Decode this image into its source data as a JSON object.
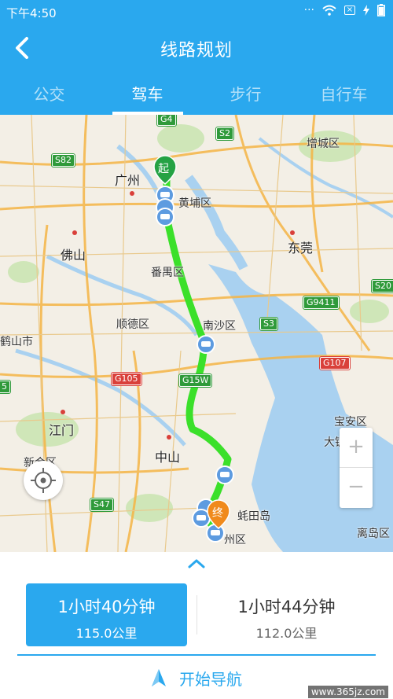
{
  "status_bar": {
    "time": "下午4:50",
    "dots": "···",
    "sim_icon": "x-box-icon"
  },
  "header": {
    "title": "线路规划"
  },
  "tabs": [
    {
      "label": "公交"
    },
    {
      "label": "驾车",
      "active": true
    },
    {
      "label": "步行"
    },
    {
      "label": "自行车"
    }
  ],
  "map": {
    "labels": {
      "guangzhou": "广州",
      "huangpu": "黄埔区",
      "zengcheng": "增城区",
      "foshan": "佛山",
      "panyu": "番禺区",
      "dongguan": "东莞",
      "shunde": "顺德区",
      "nansha": "南沙区",
      "heshan": "鹤山市",
      "jiangmen": "江门",
      "zhongshan": "中山",
      "xinhui": "新会区",
      "qi_island": "蚝田岛",
      "zhou_district": "州区",
      "baoan": "宝安区",
      "dajing": "大铲",
      "liyu": "离岛区"
    },
    "highways": [
      "G4",
      "S2",
      "S82",
      "S20",
      "G9411",
      "S3",
      "G107",
      "G105",
      "G15W",
      "S47",
      "5"
    ],
    "markers": {
      "start": "起",
      "end": "终"
    },
    "zoom_in": "+",
    "zoom_out": "−",
    "colors": {
      "route": "#3be02a",
      "water": "#a9d1f0",
      "start": "#25a244",
      "end": "#f08a1c"
    }
  },
  "routes": [
    {
      "duration": "1小时40分钟",
      "distance": "115.0公里",
      "selected": true
    },
    {
      "duration": "1小时44分钟",
      "distance": "112.0公里",
      "selected": false
    }
  ],
  "navigation": {
    "label": "开始导航"
  },
  "watermark": "www.365jz.com",
  "accent": "#2aa8ee"
}
